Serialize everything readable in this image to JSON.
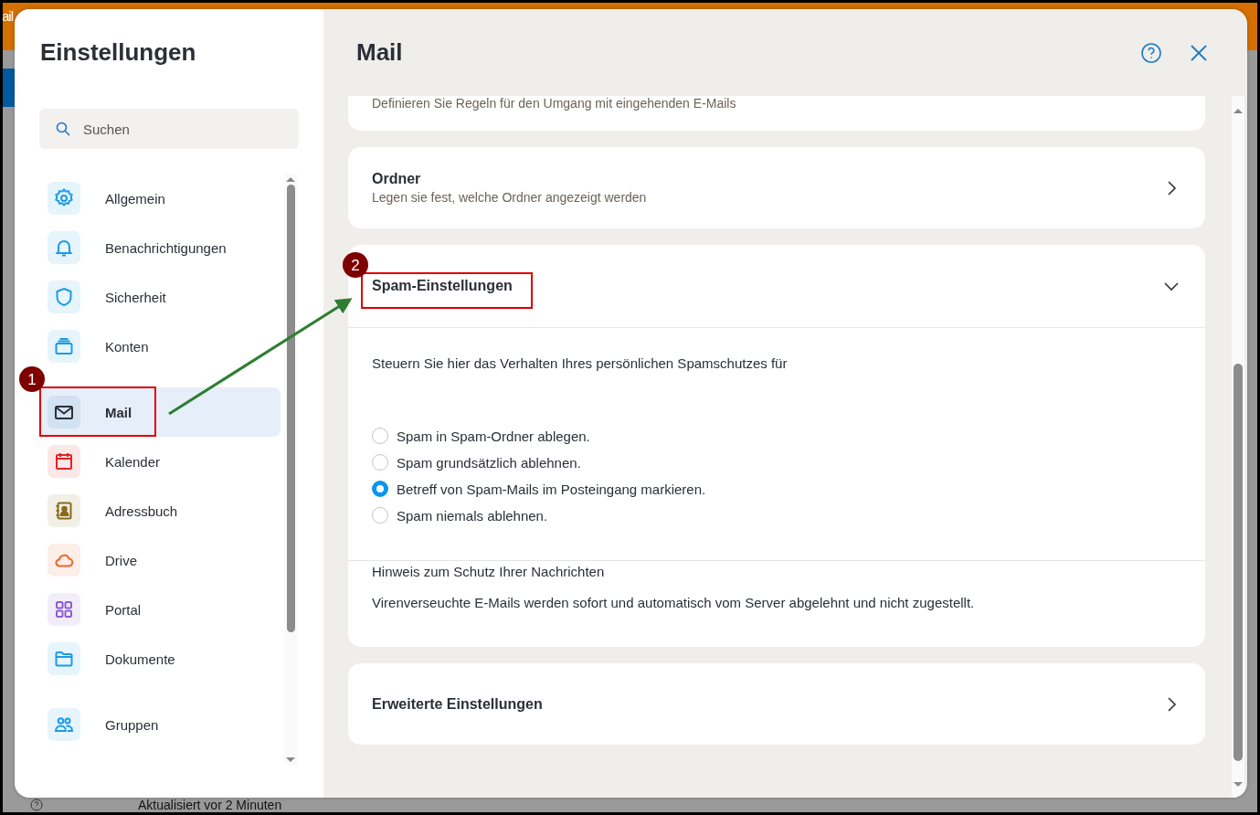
{
  "background_app": {
    "title_fragment": "ail",
    "status_text": "Aktualisiert vor 2 Minuten"
  },
  "settings": {
    "title": "Einstellungen",
    "search": {
      "placeholder": "Suchen"
    },
    "nav_sections": [
      [
        {
          "label": "Allgemein",
          "selected": false,
          "color": "#1a9be6"
        },
        {
          "label": "Benachrichtigungen",
          "selected": false,
          "color": "#1a9be6"
        },
        {
          "label": "Sicherheit",
          "selected": false,
          "color": "#1a9be6"
        },
        {
          "label": "Konten",
          "selected": false,
          "color": "#1a9be6"
        }
      ],
      [
        {
          "label": "Mail",
          "selected": true,
          "color": "#2b2f36"
        },
        {
          "label": "Kalender",
          "selected": false,
          "color": "#e02424"
        },
        {
          "label": "Adressbuch",
          "selected": false,
          "color": "#8a6a1c"
        },
        {
          "label": "Drive",
          "selected": false,
          "color": "#f2642a"
        },
        {
          "label": "Portal",
          "selected": false,
          "color": "#8b5cd6"
        },
        {
          "label": "Dokumente",
          "selected": false,
          "color": "#1a9be6"
        }
      ],
      [
        {
          "label": "Gruppen",
          "selected": false,
          "color": "#1a9be6"
        }
      ]
    ]
  },
  "page": {
    "title": "Mail",
    "cards": [
      {
        "kind": "partial",
        "description": "Definieren Sie Regeln für den Umgang mit eingehenden E-Mails"
      },
      {
        "kind": "link",
        "title": "Ordner",
        "description": "Legen sie fest, welche Ordner angezeigt werden"
      },
      {
        "kind": "section",
        "title": "Spam-Einstellungen",
        "expanded": true,
        "intro": "Steuern Sie hier das Verhalten Ihres persönlichen Spamschutzes für",
        "options": [
          {
            "label": "Spam in Spam-Ordner ablegen.",
            "selected": false
          },
          {
            "label": "Spam grundsätzlich ablehnen.",
            "selected": false
          },
          {
            "label": "Betreff von Spam-Mails im Posteingang markieren.",
            "selected": true
          },
          {
            "label": "Spam niemals ablehnen.",
            "selected": false
          }
        ],
        "note_title": "Hinweis zum Schutz Ihrer Nachrichten",
        "note": "Virenverseuchte E-Mails werden sofort und automatisch vom Server abgelehnt und nicht zugestellt."
      },
      {
        "kind": "link",
        "title": "Erweiterte Einstellungen"
      }
    ]
  },
  "annotations": [
    {
      "label": "1"
    },
    {
      "label": "2"
    }
  ]
}
